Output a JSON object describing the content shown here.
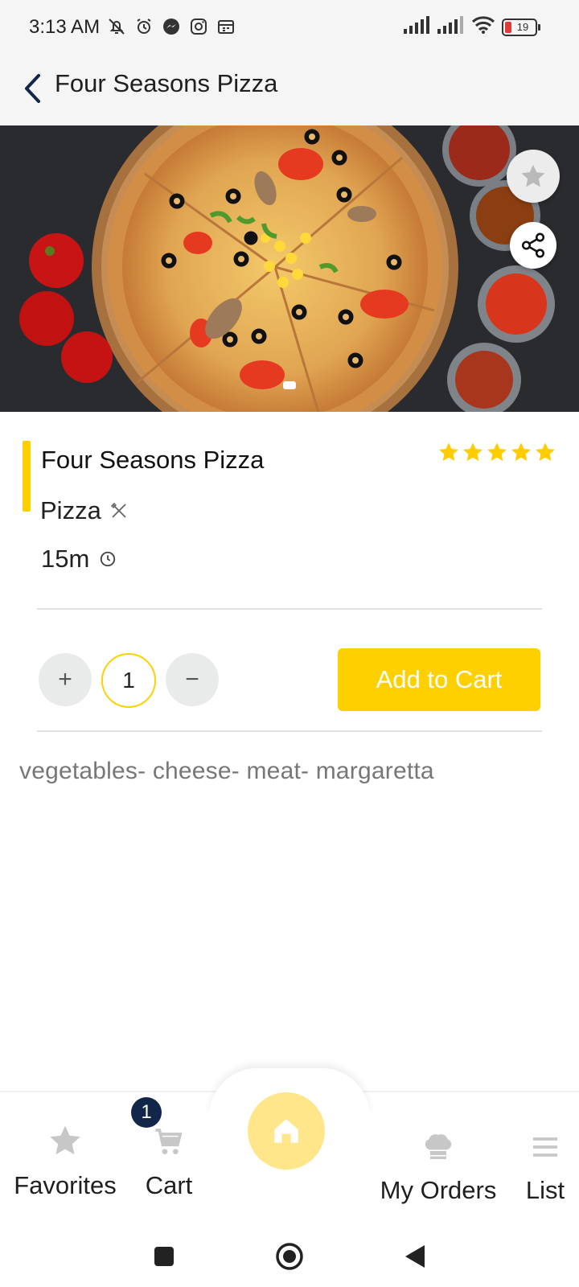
{
  "status_bar": {
    "time": "3:13 AM",
    "battery_level": "19",
    "icons": [
      "notifications-off-icon",
      "alarm-icon",
      "messenger-icon",
      "instagram-icon",
      "calendar-icon",
      "signal-icon",
      "signal-icon",
      "wifi-icon",
      "battery-icon"
    ]
  },
  "header": {
    "title": "Four Seasons Pizza",
    "back_icon": "chevron-left-icon"
  },
  "hero": {
    "image_subject": "pizza-photo",
    "favorite_icon": "star-icon",
    "share_icon": "share-icon"
  },
  "product": {
    "title": "Four Seasons Pizza",
    "category": "Pizza",
    "category_icon": "utensils-icon",
    "time": "15m",
    "time_icon": "clock-icon",
    "rating": 5,
    "rating_max": 5,
    "description": "vegetables- cheese- meat- margaretta"
  },
  "quantity": {
    "plus_label": "+",
    "value": "1",
    "minus_label": "−"
  },
  "add_to_cart_label": "Add to Cart",
  "bottom_nav": {
    "favorites_label": "Favorites",
    "cart_label": "Cart",
    "cart_badge": "1",
    "my_orders_label": "My Orders",
    "list_label": "List"
  },
  "colors": {
    "accent": "#ffd000",
    "badge": "#12264a",
    "home_button": "#ffe68a",
    "header_bg": "#f5f5f5"
  }
}
